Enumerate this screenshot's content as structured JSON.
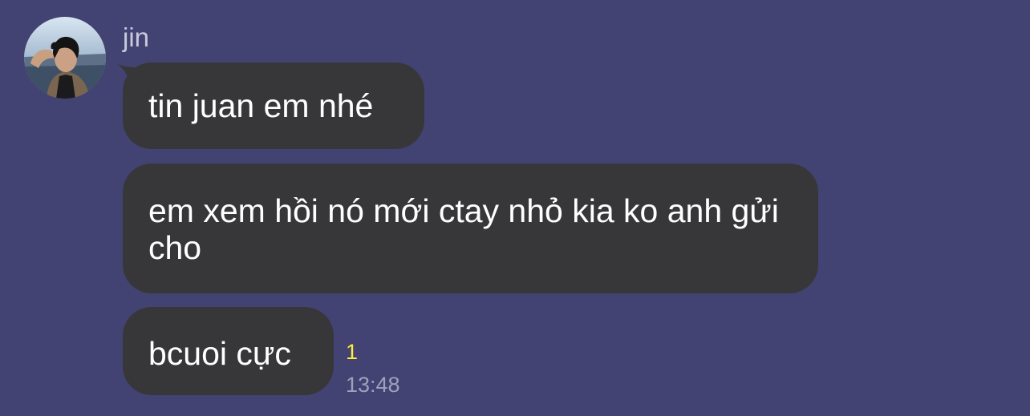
{
  "chat": {
    "sender": {
      "name": "jin",
      "avatar": "profile-photo"
    },
    "messages": [
      {
        "text": "tin juan em nhé"
      },
      {
        "text": "em xem hồi nó mới ctay nhỏ kia ko anh gửi cho"
      },
      {
        "text": "bcuoi cực"
      }
    ],
    "read_count": "1",
    "timestamp": "13:48"
  },
  "colors": {
    "background": "#424273",
    "bubble": "#373739",
    "bubble_text": "#ffffff",
    "read_count": "#ffeb3b",
    "timestamp": "#a0a0bd"
  }
}
